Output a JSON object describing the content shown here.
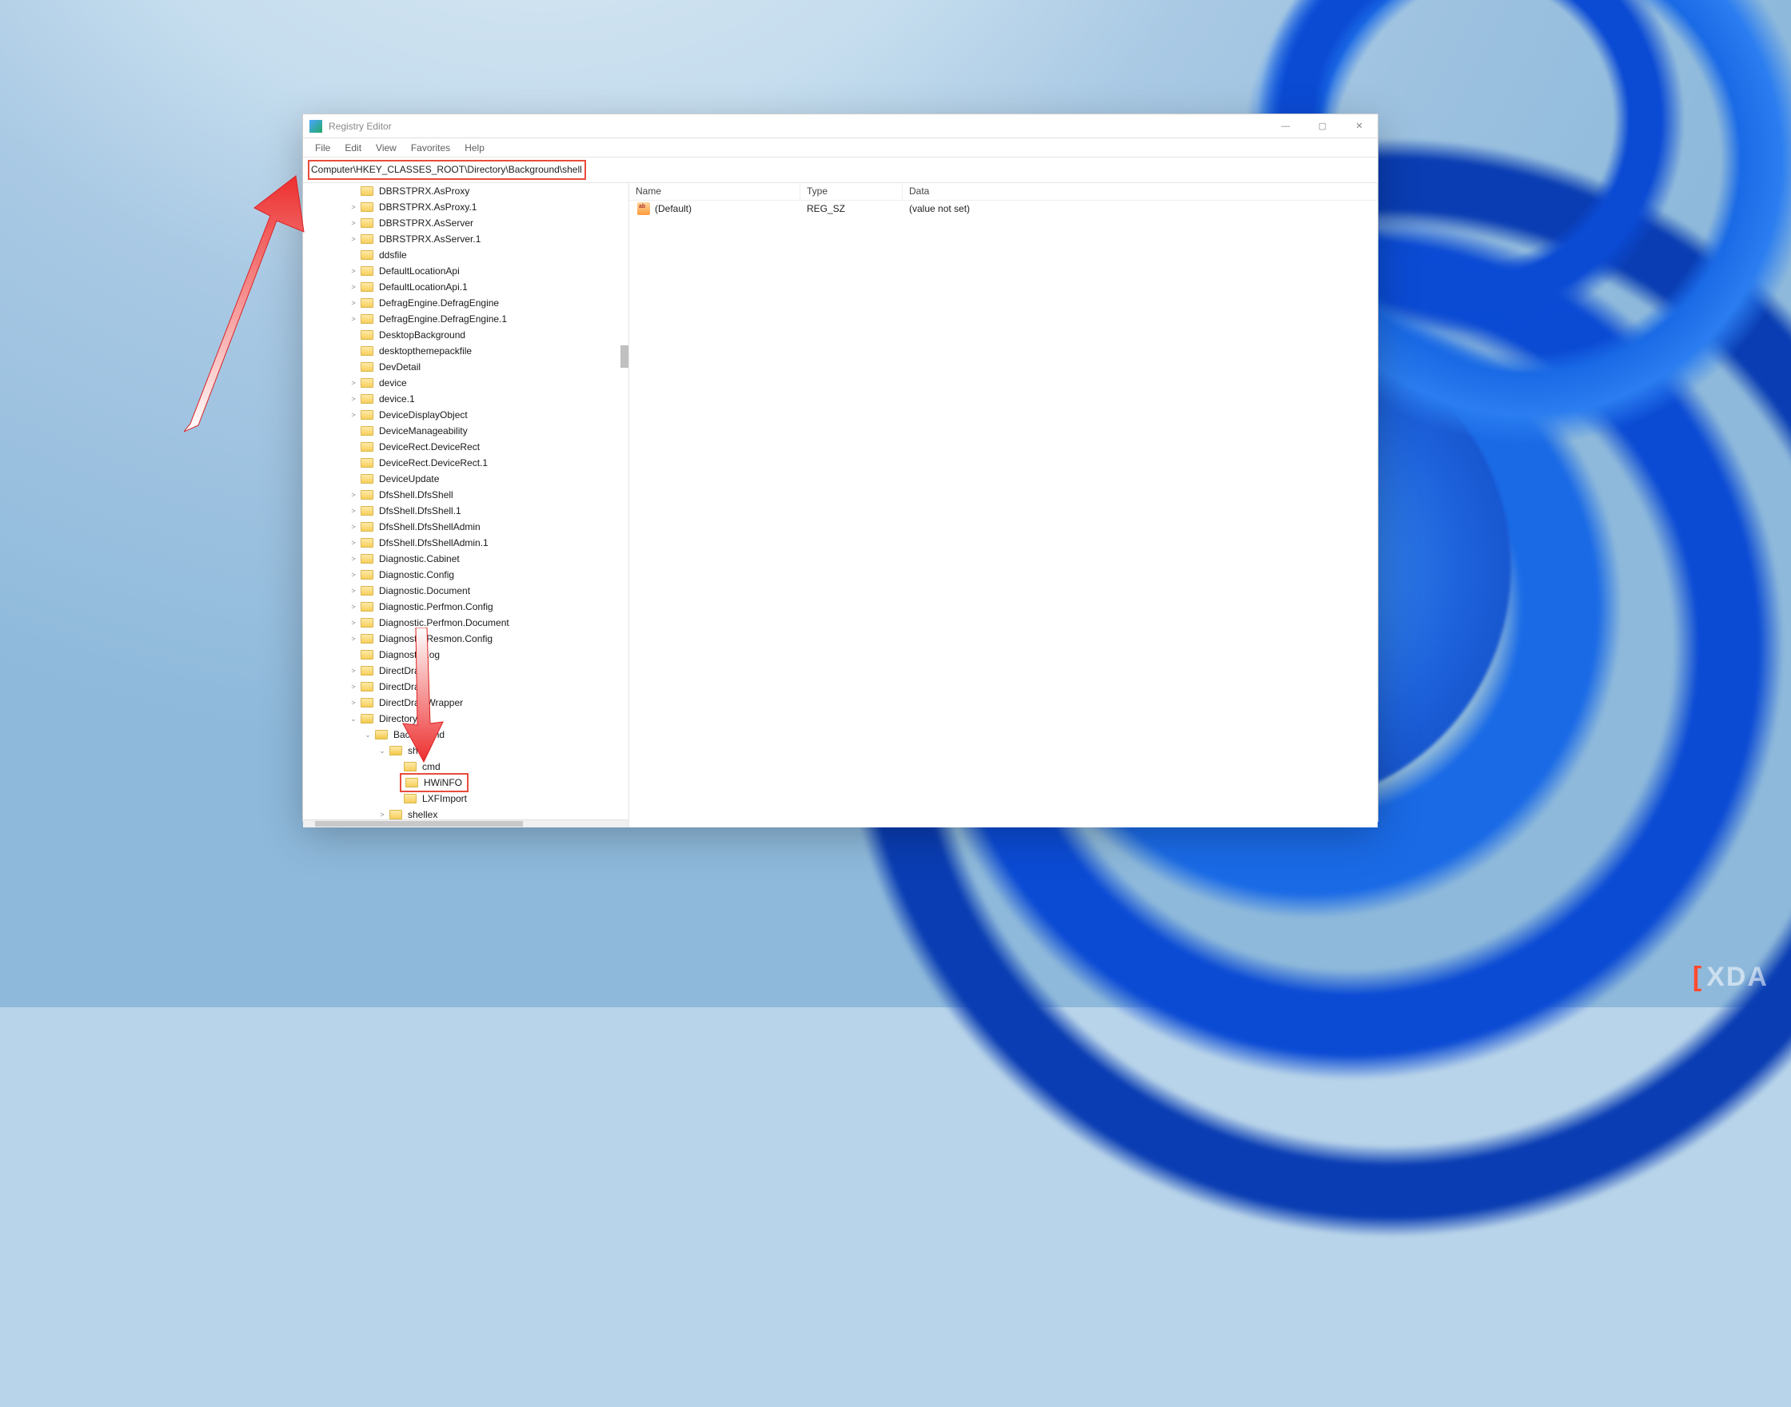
{
  "titlebar": {
    "title": "Registry Editor"
  },
  "menu": {
    "file": "File",
    "edit": "Edit",
    "view": "View",
    "favorites": "Favorites",
    "help": "Help"
  },
  "address": {
    "path": "Computer\\HKEY_CLASSES_ROOT\\Directory\\Background\\shell"
  },
  "cols": {
    "name": "Name",
    "type": "Type",
    "data": "Data"
  },
  "value_row": {
    "name": "(Default)",
    "type": "REG_SZ",
    "data": "(value not set)"
  },
  "watermark": {
    "text": "XDA"
  },
  "tree": {
    "items": [
      {
        "d": 2,
        "exp": "",
        "label": "DBRSTPRX.AsProxy"
      },
      {
        "d": 2,
        "exp": ">",
        "label": "DBRSTPRX.AsProxy.1"
      },
      {
        "d": 2,
        "exp": ">",
        "label": "DBRSTPRX.AsServer"
      },
      {
        "d": 2,
        "exp": ">",
        "label": "DBRSTPRX.AsServer.1"
      },
      {
        "d": 2,
        "exp": "",
        "label": "ddsfile"
      },
      {
        "d": 2,
        "exp": ">",
        "label": "DefaultLocationApi"
      },
      {
        "d": 2,
        "exp": ">",
        "label": "DefaultLocationApi.1"
      },
      {
        "d": 2,
        "exp": ">",
        "label": "DefragEngine.DefragEngine"
      },
      {
        "d": 2,
        "exp": ">",
        "label": "DefragEngine.DefragEngine.1"
      },
      {
        "d": 2,
        "exp": "",
        "label": "DesktopBackground"
      },
      {
        "d": 2,
        "exp": "",
        "label": "desktopthemepackfile"
      },
      {
        "d": 2,
        "exp": "",
        "label": "DevDetail"
      },
      {
        "d": 2,
        "exp": ">",
        "label": "device"
      },
      {
        "d": 2,
        "exp": ">",
        "label": "device.1"
      },
      {
        "d": 2,
        "exp": ">",
        "label": "DeviceDisplayObject"
      },
      {
        "d": 2,
        "exp": "",
        "label": "DeviceManageability"
      },
      {
        "d": 2,
        "exp": "",
        "label": "DeviceRect.DeviceRect"
      },
      {
        "d": 2,
        "exp": "",
        "label": "DeviceRect.DeviceRect.1"
      },
      {
        "d": 2,
        "exp": "",
        "label": "DeviceUpdate"
      },
      {
        "d": 2,
        "exp": ">",
        "label": "DfsShell.DfsShell"
      },
      {
        "d": 2,
        "exp": ">",
        "label": "DfsShell.DfsShell.1"
      },
      {
        "d": 2,
        "exp": ">",
        "label": "DfsShell.DfsShellAdmin"
      },
      {
        "d": 2,
        "exp": ">",
        "label": "DfsShell.DfsShellAdmin.1"
      },
      {
        "d": 2,
        "exp": ">",
        "label": "Diagnostic.Cabinet"
      },
      {
        "d": 2,
        "exp": ">",
        "label": "Diagnostic.Config"
      },
      {
        "d": 2,
        "exp": ">",
        "label": "Diagnostic.Document"
      },
      {
        "d": 2,
        "exp": ">",
        "label": "Diagnostic.Perfmon.Config"
      },
      {
        "d": 2,
        "exp": ">",
        "label": "Diagnostic.Perfmon.Document"
      },
      {
        "d": 2,
        "exp": ">",
        "label": "Diagnostic.Resmon.Config"
      },
      {
        "d": 2,
        "exp": "",
        "label": "DiagnosticLog"
      },
      {
        "d": 2,
        "exp": ">",
        "label": "DirectDraw"
      },
      {
        "d": 2,
        "exp": ">",
        "label": "DirectDraw"
      },
      {
        "d": 2,
        "exp": ">",
        "label": "DirectDrawWrapper"
      },
      {
        "d": 2,
        "exp": "v",
        "label": "Directory",
        "open": true
      },
      {
        "d": 3,
        "exp": "v",
        "label": "Background",
        "open": true
      },
      {
        "d": 4,
        "exp": "v",
        "label": "shell",
        "open": true
      },
      {
        "d": 5,
        "exp": "",
        "label": "cmd"
      },
      {
        "d": 5,
        "exp": "",
        "label": "HWiNFO",
        "highlight": true
      },
      {
        "d": 5,
        "exp": "",
        "label": "LXFImport"
      },
      {
        "d": 4,
        "exp": ">",
        "label": "shellex"
      }
    ]
  }
}
